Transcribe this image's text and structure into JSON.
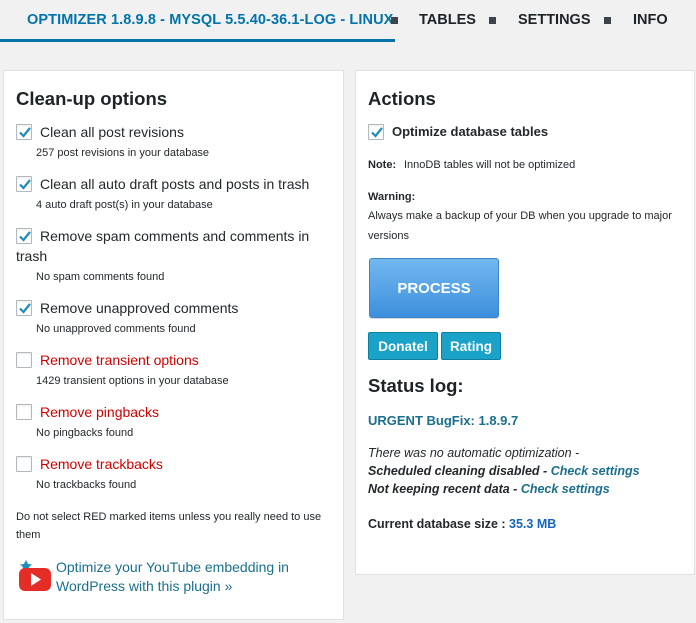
{
  "tabs": {
    "active": "OPTIMIZER 1.8.9.8 - MYSQL 5.5.40-36.1-LOG - LINUX",
    "tables": "TABLES",
    "settings": "SETTINGS",
    "info": "INFO"
  },
  "cleanup": {
    "title": "Clean-up options",
    "options": [
      {
        "label": "Clean all post revisions",
        "sub": "257 post revisions in your database",
        "checked": true,
        "red": false
      },
      {
        "label": "Clean all auto draft posts and posts in trash",
        "sub": "4 auto draft post(s) in your database",
        "checked": true,
        "red": false
      },
      {
        "label": "Remove spam comments and comments in",
        "label2": "trash",
        "sub": "No spam comments found",
        "checked": true,
        "red": false
      },
      {
        "label": "Remove unapproved comments",
        "sub": "No unapproved comments found",
        "checked": true,
        "red": false
      },
      {
        "label": "Remove transient options",
        "sub": "1429 transient options in your database",
        "checked": false,
        "red": true
      },
      {
        "label": "Remove pingbacks",
        "sub": "No pingbacks found",
        "checked": false,
        "red": true
      },
      {
        "label": "Remove trackbacks",
        "sub": "No trackbacks found",
        "checked": false,
        "red": true
      }
    ],
    "note_line1": "Do not select RED marked items unless you really need to use",
    "note_line2": "them",
    "yt_link_line1": "Optimize your YouTube embedding in",
    "yt_link_line2": "WordPress with this plugin »",
    "yt_icon": "youtube-icon"
  },
  "actions": {
    "title": "Actions",
    "optimize_label": "Optimize database tables",
    "optimize_checked": true,
    "note_label": "Note:",
    "note_text": "InnoDB tables will not be optimized",
    "warning_label": "Warning:",
    "warning_line1": "Always make a backup of your DB when you upgrade to major",
    "warning_line2": "versions",
    "process_button": "PROCESS",
    "donate_button": "Donatel",
    "rating_button": "Rating"
  },
  "status": {
    "title": "Status log:",
    "bugfix": "URGENT BugFix: 1.8.9.7",
    "line1": "There was no automatic optimization -",
    "line2_text": "Scheduled cleaning disabled - ",
    "line2_link": "Check settings",
    "line3_text": "Not keeping recent data - ",
    "line3_link": "Check settings",
    "db_size_label": "Current database size : ",
    "db_size_value": "35.3 MB"
  },
  "colors": {
    "accent": "#0073aa",
    "link": "#1a6f8e",
    "danger": "#d00000",
    "process": "#4a9ae2",
    "small_button": "#1aa2c9"
  }
}
